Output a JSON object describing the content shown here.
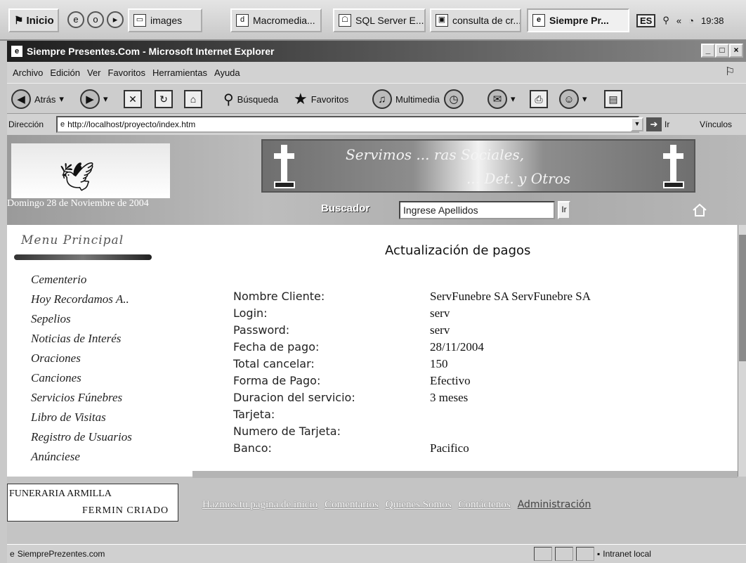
{
  "taskbar": {
    "start_label": "Inicio",
    "buttons": [
      {
        "label": "images"
      },
      {
        "label": "Macromedia..."
      },
      {
        "label": "SQL Server E..."
      },
      {
        "label": "consulta de cr..."
      },
      {
        "label": "Siempre Pr..."
      }
    ],
    "language": "ES",
    "clock": "19:38"
  },
  "window": {
    "title": "Siempre Presentes.Com - Microsoft Internet Explorer",
    "menu": [
      "Archivo",
      "Edición",
      "Ver",
      "Favoritos",
      "Herramientas",
      "Ayuda"
    ],
    "toolbar": {
      "back": "Atrás",
      "search": "Búsqueda",
      "favorites": "Favoritos",
      "multimedia": "Multimedia"
    },
    "address": {
      "label": "Dirección",
      "url": "http://localhost/proyecto/index.htm",
      "go": "Ir",
      "links": "Vínculos"
    },
    "status": {
      "text": "SiemprePrezentes.com",
      "zone": "Intranet local"
    }
  },
  "page": {
    "banner_text_1": "Servimos ... ras Sociales,",
    "banner_text_2": "... Det. y Otros",
    "date": "Domingo 28 de Noviembre de 2004",
    "search_label": "Buscador",
    "search_value": "Ingrese Apellidos",
    "search_button": "Ir",
    "menu_title": "Menu Principal",
    "menu_items": [
      "Cementerio",
      "Hoy Recordamos A..",
      "Sepelios",
      "Noticias de Interés",
      "Oraciones",
      "Canciones",
      "Servicios Fúnebres",
      "Libro de Visitas",
      "Registro de Usuarios",
      "Anúnciese"
    ],
    "content_title": "Actualización de pagos",
    "fields": [
      {
        "label": "Nombre Cliente:",
        "value": "ServFunebre SA ServFunebre SA"
      },
      {
        "label": "Login:",
        "value": "serv"
      },
      {
        "label": "Password:",
        "value": "serv"
      },
      {
        "label": "Fecha de pago:",
        "value": "28/11/2004"
      },
      {
        "label": "Total cancelar:",
        "value": "150"
      },
      {
        "label": "Forma de Pago:",
        "value": "Efectivo"
      },
      {
        "label": "Duracion del servicio:",
        "value": "3 meses"
      },
      {
        "label": "Tarjeta:",
        "value": ""
      },
      {
        "label": "Numero de Tarjeta:",
        "value": ""
      },
      {
        "label": "Banco:",
        "value": "Pacifico"
      }
    ],
    "footer_company_1": "FUNERARIA ARMILLA",
    "footer_company_2": "FERMIN CRIADO",
    "footer_links": [
      "Hazmos tu pagina de inicio",
      "Comentarios",
      "Quienes Somos",
      "Contáctenos",
      "Administración"
    ]
  }
}
